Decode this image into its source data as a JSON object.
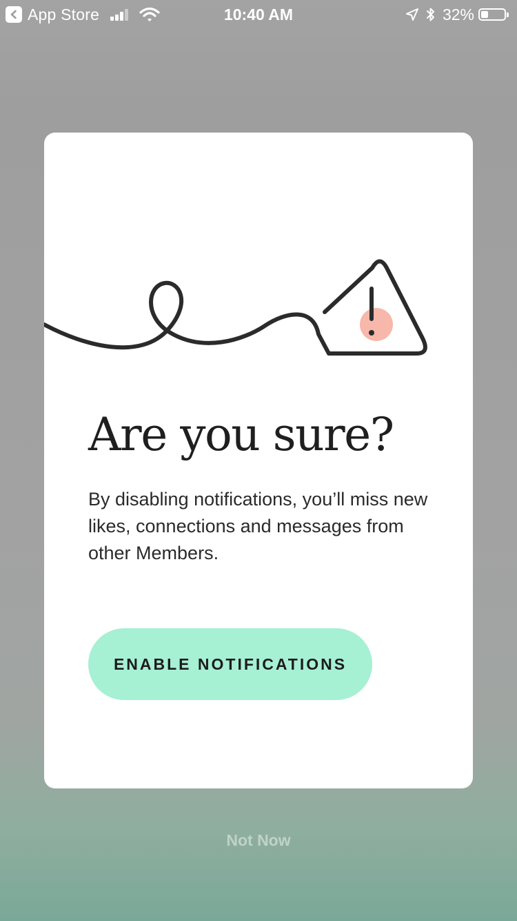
{
  "status_bar": {
    "back_app": "App Store",
    "time": "10:40 AM",
    "battery_percent": "32%",
    "battery_level": 0.32,
    "icons": [
      "back-arrow-icon",
      "signal-icon",
      "wifi-icon",
      "location-icon",
      "bluetooth-icon",
      "battery-icon"
    ]
  },
  "dialog": {
    "title": "Are you sure?",
    "body": "By disabling notifications, you’ll miss new likes, connections and messages from other Members.",
    "primary_button": "ENABLE NOTIFICATIONS",
    "illustration_icon": "warning-triangle-icon"
  },
  "secondary_action": "Not Now",
  "colors": {
    "button_bg": "#a6f0d4",
    "accent_dot": "#f7b7aa",
    "line": "#2b2b2b",
    "card_bg": "#ffffff"
  }
}
